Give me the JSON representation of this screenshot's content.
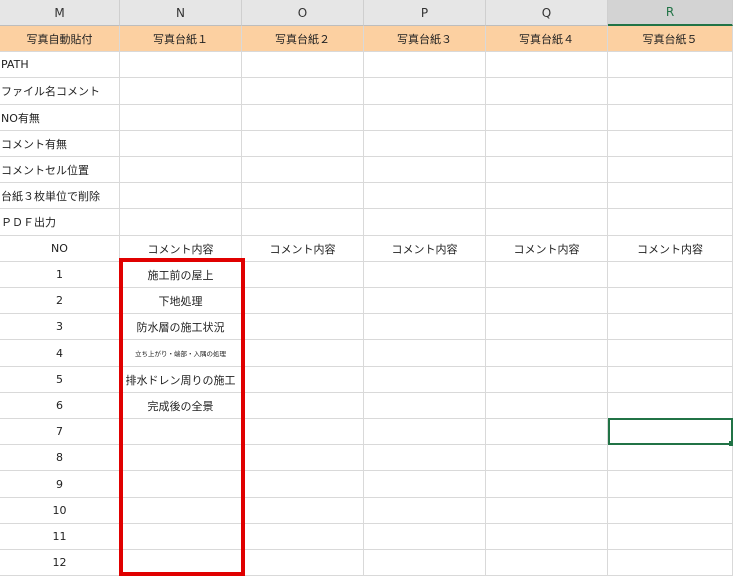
{
  "columns": [
    "M",
    "N",
    "O",
    "P",
    "Q",
    "R"
  ],
  "active_column": "R",
  "header_row": [
    "写真自動貼付",
    "写真台紙１",
    "写真台紙２",
    "写真台紙３",
    "写真台紙４",
    "写真台紙５"
  ],
  "setting_labels": [
    "PATH",
    "ファイル名コメント",
    "NO有無",
    "コメント有無",
    "コメントセル位置",
    "台紙３枚単位で削除",
    "ＰＤＦ出力"
  ],
  "table_header": [
    "NO",
    "コメント内容",
    "コメント内容",
    "コメント内容",
    "コメント内容",
    "コメント内容"
  ],
  "rows": [
    {
      "no": "1",
      "comment": "施工前の屋上"
    },
    {
      "no": "2",
      "comment": "下地処理"
    },
    {
      "no": "3",
      "comment": "防水層の施工状況"
    },
    {
      "no": "4",
      "comment": "立ち上がり・端部・入隅の処理"
    },
    {
      "no": "5",
      "comment": "排水ドレン周りの施工"
    },
    {
      "no": "6",
      "comment": "完成後の全景"
    },
    {
      "no": "7",
      "comment": ""
    },
    {
      "no": "8",
      "comment": ""
    },
    {
      "no": "9",
      "comment": ""
    },
    {
      "no": "10",
      "comment": ""
    },
    {
      "no": "11",
      "comment": ""
    },
    {
      "no": "12",
      "comment": ""
    }
  ],
  "colors": {
    "header_fill": "#fcd0a1",
    "highlight_border": "#e00000",
    "selection": "#217346"
  }
}
